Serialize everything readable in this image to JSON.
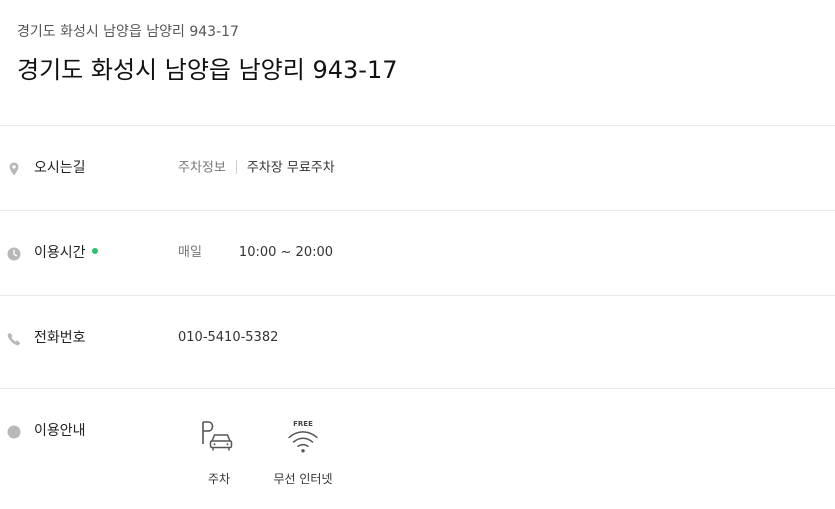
{
  "header": {
    "breadcrumb": "경기도 화성시 남양읍 남양리 943-17",
    "title": "경기도 화성시 남양읍 남양리 943-17"
  },
  "directions": {
    "label": "오시는길",
    "info_label": "주차정보",
    "info_value": "주차장 무료주차"
  },
  "hours": {
    "label": "이용시간",
    "status_color": "#2ec26b",
    "day": "매일",
    "time": "10:00 ~ 20:00"
  },
  "phone": {
    "label": "전화번호",
    "number": "010-5410-5382"
  },
  "amenities": {
    "label": "이용안내",
    "items": [
      {
        "icon": "parking-icon",
        "label": "주차"
      },
      {
        "icon": "wifi-icon",
        "badge": "FREE",
        "label": "무선 인터넷"
      }
    ]
  }
}
